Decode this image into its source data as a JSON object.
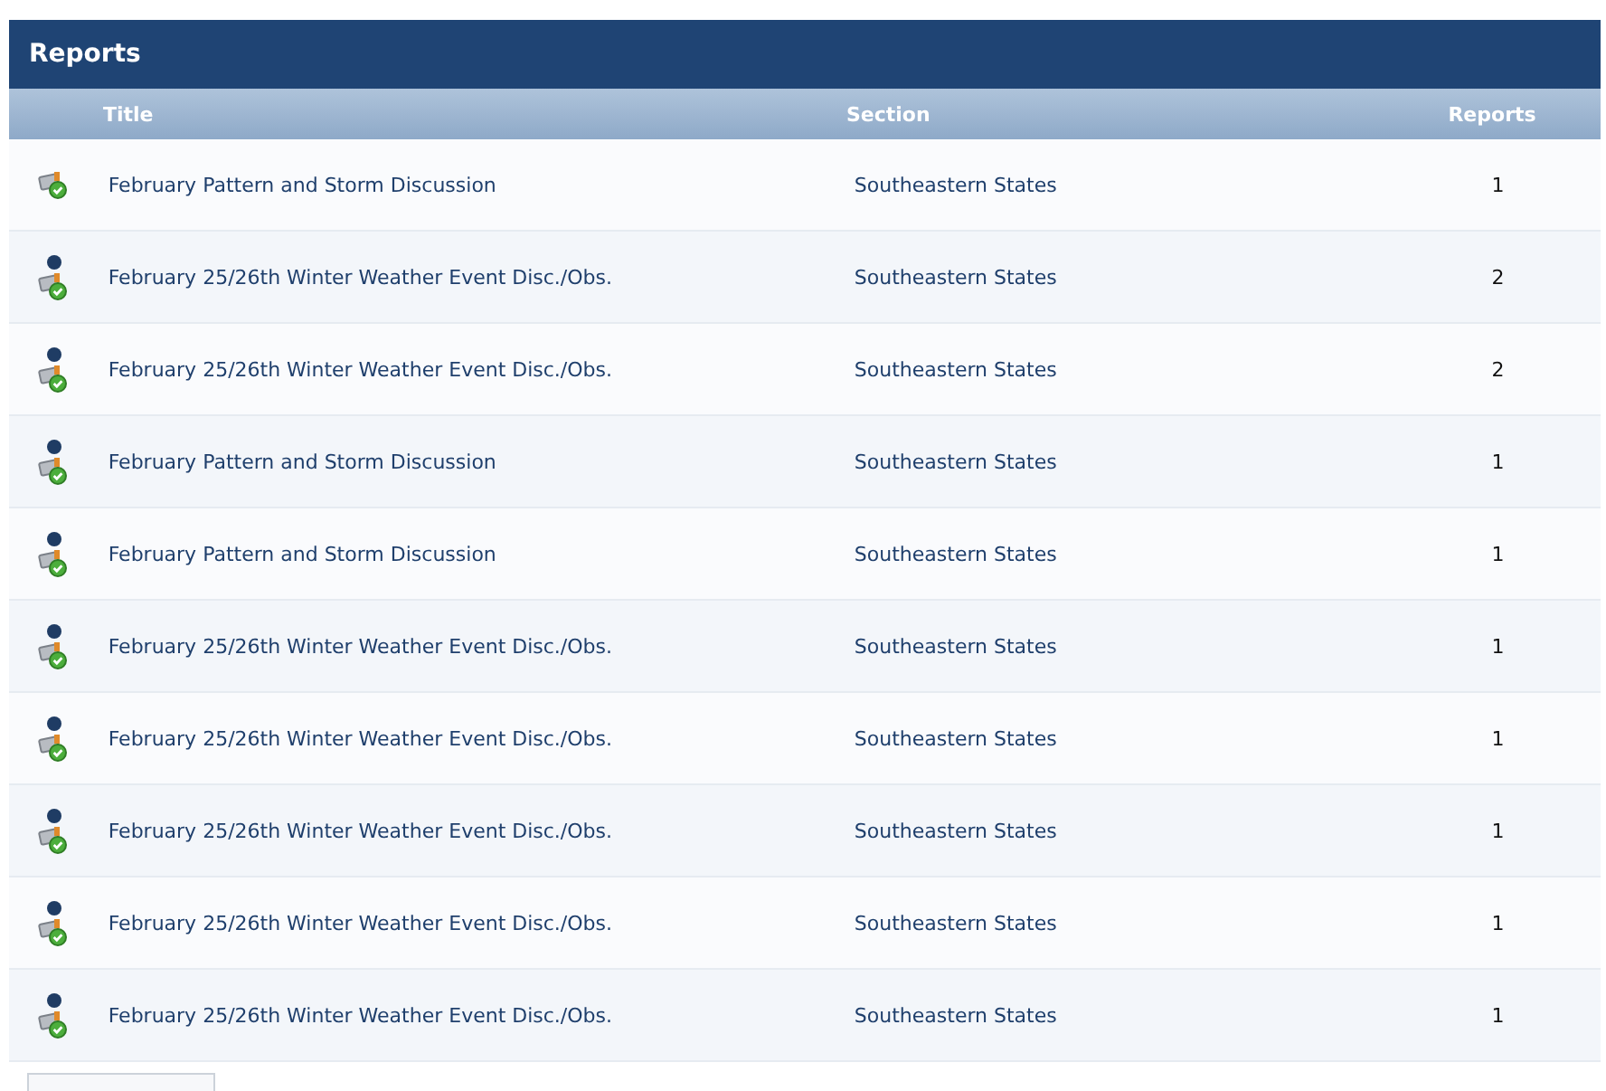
{
  "panel": {
    "title": "Reports"
  },
  "table": {
    "columns": [
      "Title",
      "Section",
      "Reports"
    ],
    "rows": [
      {
        "unread": false,
        "title": "February Pattern and Storm Discussion",
        "section": "Southeastern States",
        "reports": "1"
      },
      {
        "unread": true,
        "title": "February 25/26th Winter Weather Event Disc./Obs.",
        "section": "Southeastern States",
        "reports": "2"
      },
      {
        "unread": true,
        "title": "February 25/26th Winter Weather Event Disc./Obs.",
        "section": "Southeastern States",
        "reports": "2"
      },
      {
        "unread": true,
        "title": "February Pattern and Storm Discussion",
        "section": "Southeastern States",
        "reports": "1"
      },
      {
        "unread": true,
        "title": "February Pattern and Storm Discussion",
        "section": "Southeastern States",
        "reports": "1"
      },
      {
        "unread": true,
        "title": "February 25/26th Winter Weather Event Disc./Obs.",
        "section": "Southeastern States",
        "reports": "1"
      },
      {
        "unread": true,
        "title": "February 25/26th Winter Weather Event Disc./Obs.",
        "section": "Southeastern States",
        "reports": "1"
      },
      {
        "unread": true,
        "title": "February 25/26th Winter Weather Event Disc./Obs.",
        "section": "Southeastern States",
        "reports": "1"
      },
      {
        "unread": true,
        "title": "February 25/26th Winter Weather Event Disc./Obs.",
        "section": "Southeastern States",
        "reports": "1"
      },
      {
        "unread": true,
        "title": "February 25/26th Winter Weather Event Disc./Obs.",
        "section": "Southeastern States",
        "reports": "1"
      }
    ]
  }
}
